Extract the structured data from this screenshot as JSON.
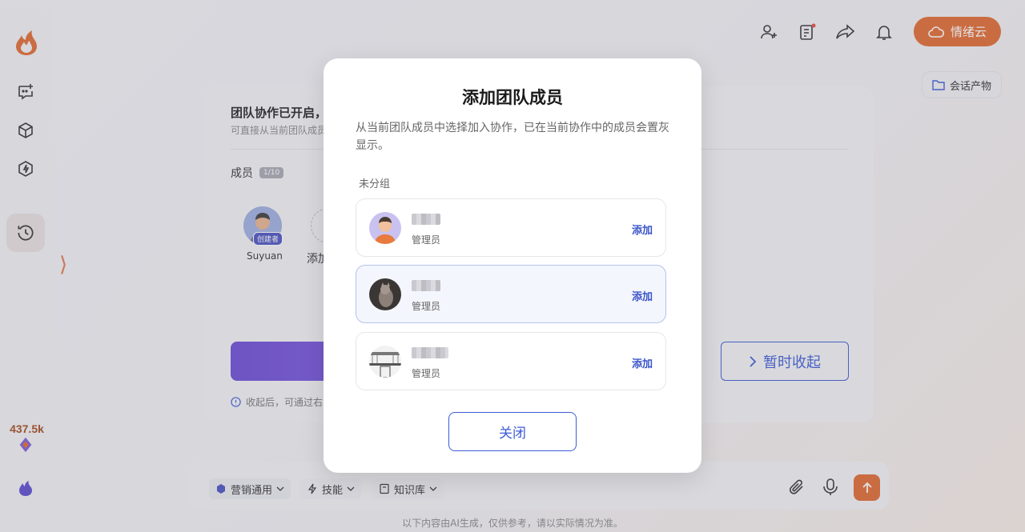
{
  "topbar": {
    "cloud_label": "情绪云",
    "artifacts_label": "会话产物"
  },
  "rail": {
    "count": "437.5k"
  },
  "card": {
    "title": "团队协作已开启，",
    "subtitle": "可直接从当前团队成员",
    "members_label": "成员",
    "members_count": "1/10",
    "member": {
      "name": "Suyuan",
      "badge": "创建者"
    },
    "add_label": "添加",
    "collapse_label": "暂时收起",
    "note": "收起后，可通过右"
  },
  "input_bar": {
    "chips": [
      "营销通用",
      "技能",
      "知识库"
    ]
  },
  "footer_note": "以下内容由AI生成，仅供参考，请以实际情况为准。",
  "modal": {
    "title": "添加团队成员",
    "description": "从当前团队成员中选择加入协作，已在当前协作中的成员会置灰显示。",
    "group_label": "未分组",
    "members": [
      {
        "role": "管理员",
        "add_label": "添加"
      },
      {
        "role": "管理员",
        "add_label": "添加"
      },
      {
        "role": "管理员",
        "add_label": "添加"
      }
    ],
    "close_label": "关闭"
  },
  "colors": {
    "accent": "#e26a2f",
    "primary_blue": "#3e5bd6",
    "purple": "#6c4bd6"
  }
}
